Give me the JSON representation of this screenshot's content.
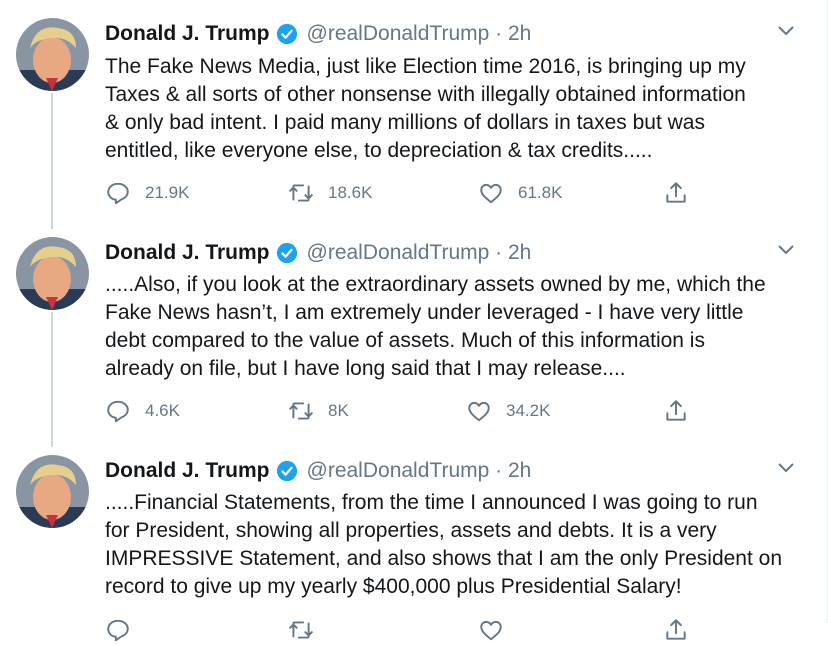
{
  "colors": {
    "verified": "#1da1f2",
    "muted": "#657786",
    "thread": "#ccd6dd"
  },
  "tweets": [
    {
      "name": "Donald J. Trump",
      "handle": "@realDonaldTrump · 2h",
      "text": "The Fake News Media, just like Election time 2016, is bringing up my\nTaxes & all sorts of other nonsense with illegally obtained information\n& only bad intent. I paid many millions of dollars in taxes but was\nentitled, like everyone else, to depreciation & tax credits.....",
      "replies": "21.9K",
      "retweets": "18.6K",
      "likes": "61.8K"
    },
    {
      "name": "Donald J. Trump",
      "handle": "@realDonaldTrump · 2h",
      "text": ".....Also, if you look at the extraordinary assets owned by me, which the\nFake News hasn’t, I am extremely under leveraged - I have very little\ndebt compared to the value of assets. Much of this information is\nalready on file, but I have long said that I may release....",
      "replies": "4.6K",
      "retweets": "8K",
      "likes": "34.2K"
    },
    {
      "name": "Donald J. Trump",
      "handle": "@realDonaldTrump · 2h",
      "text": ".....Financial Statements, from  the time I announced I was going to run\nfor President,  showing all properties, assets and debts. It is a very\nIMPRESSIVE Statement, and also shows that I am the only President on\nrecord to give up my yearly $400,000 plus Presidential Salary!"
    }
  ]
}
